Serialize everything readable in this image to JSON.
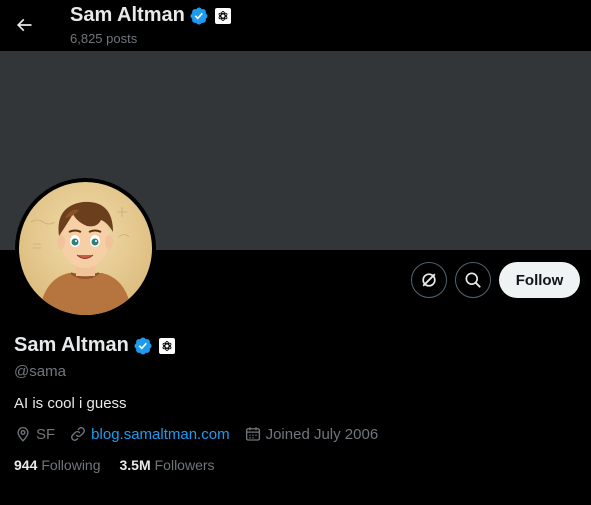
{
  "header": {
    "name": "Sam Altman",
    "posts_count": "6,825 posts"
  },
  "profile": {
    "name": "Sam Altman",
    "handle": "@sama",
    "bio": "AI is cool i guess",
    "location": "SF",
    "website": "blog.samaltman.com",
    "joined": "Joined July 2006",
    "following_count": "944",
    "following_label": "Following",
    "followers_count": "3.5M",
    "followers_label": "Followers"
  },
  "actions": {
    "follow_label": "Follow"
  },
  "icons": {
    "back": "arrow-left-icon",
    "verified": "verified-badge-icon",
    "affiliate": "openai-logo-icon",
    "grok": "grok-icon",
    "search": "search-icon",
    "location": "location-pin-icon",
    "link": "link-icon",
    "calendar": "calendar-icon"
  },
  "colors": {
    "background": "#000000",
    "banner": "#333639",
    "accent": "#1d9bf0",
    "muted_text": "#71767b",
    "primary_text": "#e7e9ea",
    "follow_button_bg": "#eff3f4"
  }
}
